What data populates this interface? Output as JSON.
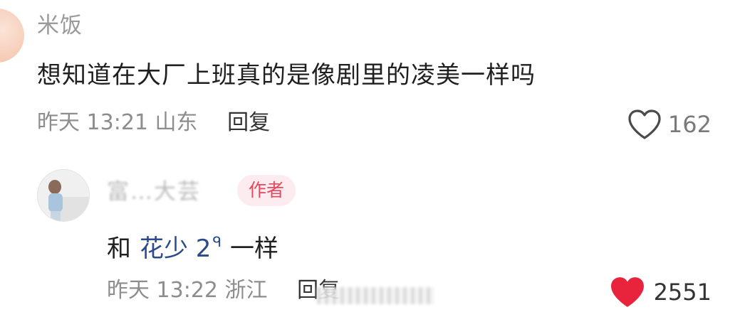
{
  "comment": {
    "username": "米饭",
    "text": "想知道在大厂上班真的是像剧里的凌美一样吗",
    "time": "昨天 13:21",
    "location": "山东",
    "reply_label": "回复",
    "likes": "162",
    "liked": false
  },
  "reply": {
    "username": "富…大芸",
    "badge": "作者",
    "text_prefix": "和",
    "mention": "花少 2",
    "mention_suffix": "ᑫ",
    "text_suffix": "一样",
    "time": "昨天 13:22",
    "location": "浙江",
    "reply_label": "回复",
    "likes": "2551",
    "liked": true
  },
  "colors": {
    "like_active": "#e8243c",
    "mention": "#2b4a8c",
    "badge_text": "#e5475d",
    "badge_bg": "#fdecef"
  },
  "icons": {
    "like": "heart-outline-icon",
    "like_active": "heart-filled-icon"
  }
}
